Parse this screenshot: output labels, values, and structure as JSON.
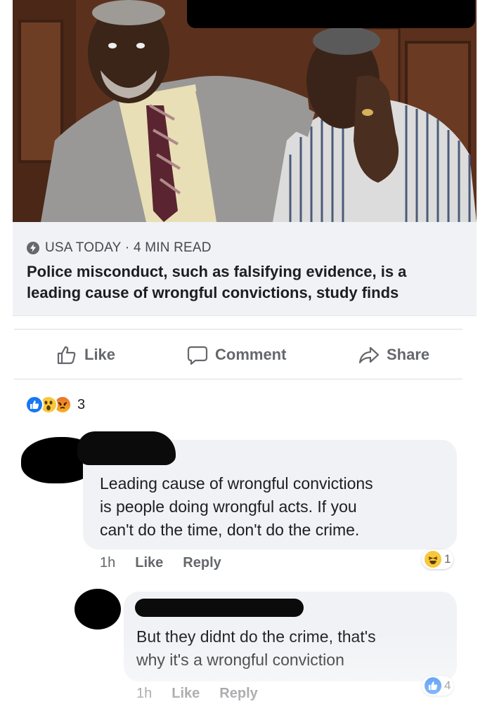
{
  "article": {
    "photo_alt": "photo",
    "source": "USA TODAY",
    "read_time": "4 MIN READ",
    "headline": "Police misconduct, such as falsifying evidence, is a leading cause of wrongful convictions, study finds"
  },
  "actions": {
    "like": "Like",
    "comment": "Comment",
    "share": "Share"
  },
  "reactions": {
    "types": [
      "like-icon",
      "wow-icon",
      "angry-icon"
    ],
    "count": "3"
  },
  "comments": [
    {
      "text_lines": [
        "Leading cause of wrongful convictions",
        "is people doing wrongful acts. If you",
        "can't do the time, don't do the crime."
      ],
      "time": "1h",
      "like": "Like",
      "reply": "Reply",
      "reaction_icon": "haha-icon",
      "reaction_count": "1"
    },
    {
      "text_lines": [
        "But they didnt do the crime, that's",
        "why it's a wrongful conviction"
      ],
      "time": "1h",
      "like": "Like",
      "reply": "Reply",
      "reaction_icon": "like-icon",
      "reaction_count": "4"
    }
  ],
  "colors": {
    "like_blue": "#1877f2",
    "meta_gray": "#65676b",
    "bubble_bg": "#f0f2f5"
  }
}
